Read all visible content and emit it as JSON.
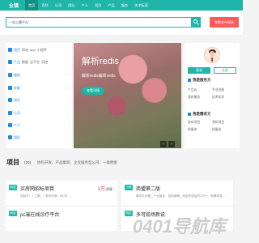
{
  "app": {
    "logo": "全镇"
  },
  "nav": {
    "items": [
      "首页",
      "百科",
      "公司",
      "团队",
      "个人",
      "项目",
      "产品",
      "服务",
      "技术标签"
    ],
    "active_index": 0
  },
  "search": {
    "placeholder": "一站公署平台",
    "post_button": "免费发布服务"
  },
  "categories": [
    {
      "main": "项目",
      "subs": [
        "网站",
        "app",
        "小程序"
      ]
    },
    {
      "main": "产品",
      "subs": [
        "数据",
        "云平台",
        "风控"
      ]
    },
    {
      "main": "服务",
      "subs": []
    },
    {
      "main": "技能",
      "subs": []
    },
    {
      "main": "知识",
      "subs": []
    },
    {
      "main": "公司",
      "subs": []
    },
    {
      "main": "个人",
      "subs": []
    },
    {
      "main": "团队",
      "subs": []
    }
  ],
  "banner": {
    "title": "解析redis",
    "subtitle": "解析redis解析redis",
    "button": "查看详情",
    "prev": "‹",
    "next": "›"
  },
  "user": {
    "login": "登录",
    "register": "注册",
    "service_heading": "我是服务方",
    "service_links": [
      "产品价",
      "专业技能",
      "我的服务",
      "技术知识"
    ],
    "demand_heading": "我是需求方",
    "demand_links": [
      "发布项目",
      "我的项目",
      "找服务",
      "找服务"
    ]
  },
  "projects": {
    "title": "项目",
    "count": "(20)",
    "desc": "协包开发、产品集装、企业服务型公司、一级佣金",
    "cards": [
      {
        "tag": "网站",
        "title": "买房网招标项目",
        "price": "1万",
        "unit": "/预算",
        "line": "招标方：1 工期：1 发布时间：06-20"
      },
      {
        "tag": "小程",
        "title": "商盟第二版",
        "price": "",
        "unit": "",
        "line": "服务平台第二个大版本，包括原稿、改定完成后的170个、新需求变..."
      },
      {
        "tag": "网站",
        "title": "pc端在线诊疗平台",
        "price": "",
        "unit": "",
        "line": ""
      },
      {
        "tag": "网站",
        "title": "多可缆场新说",
        "price": "",
        "unit": "",
        "line": ""
      }
    ]
  },
  "watermark": "0401导航库"
}
